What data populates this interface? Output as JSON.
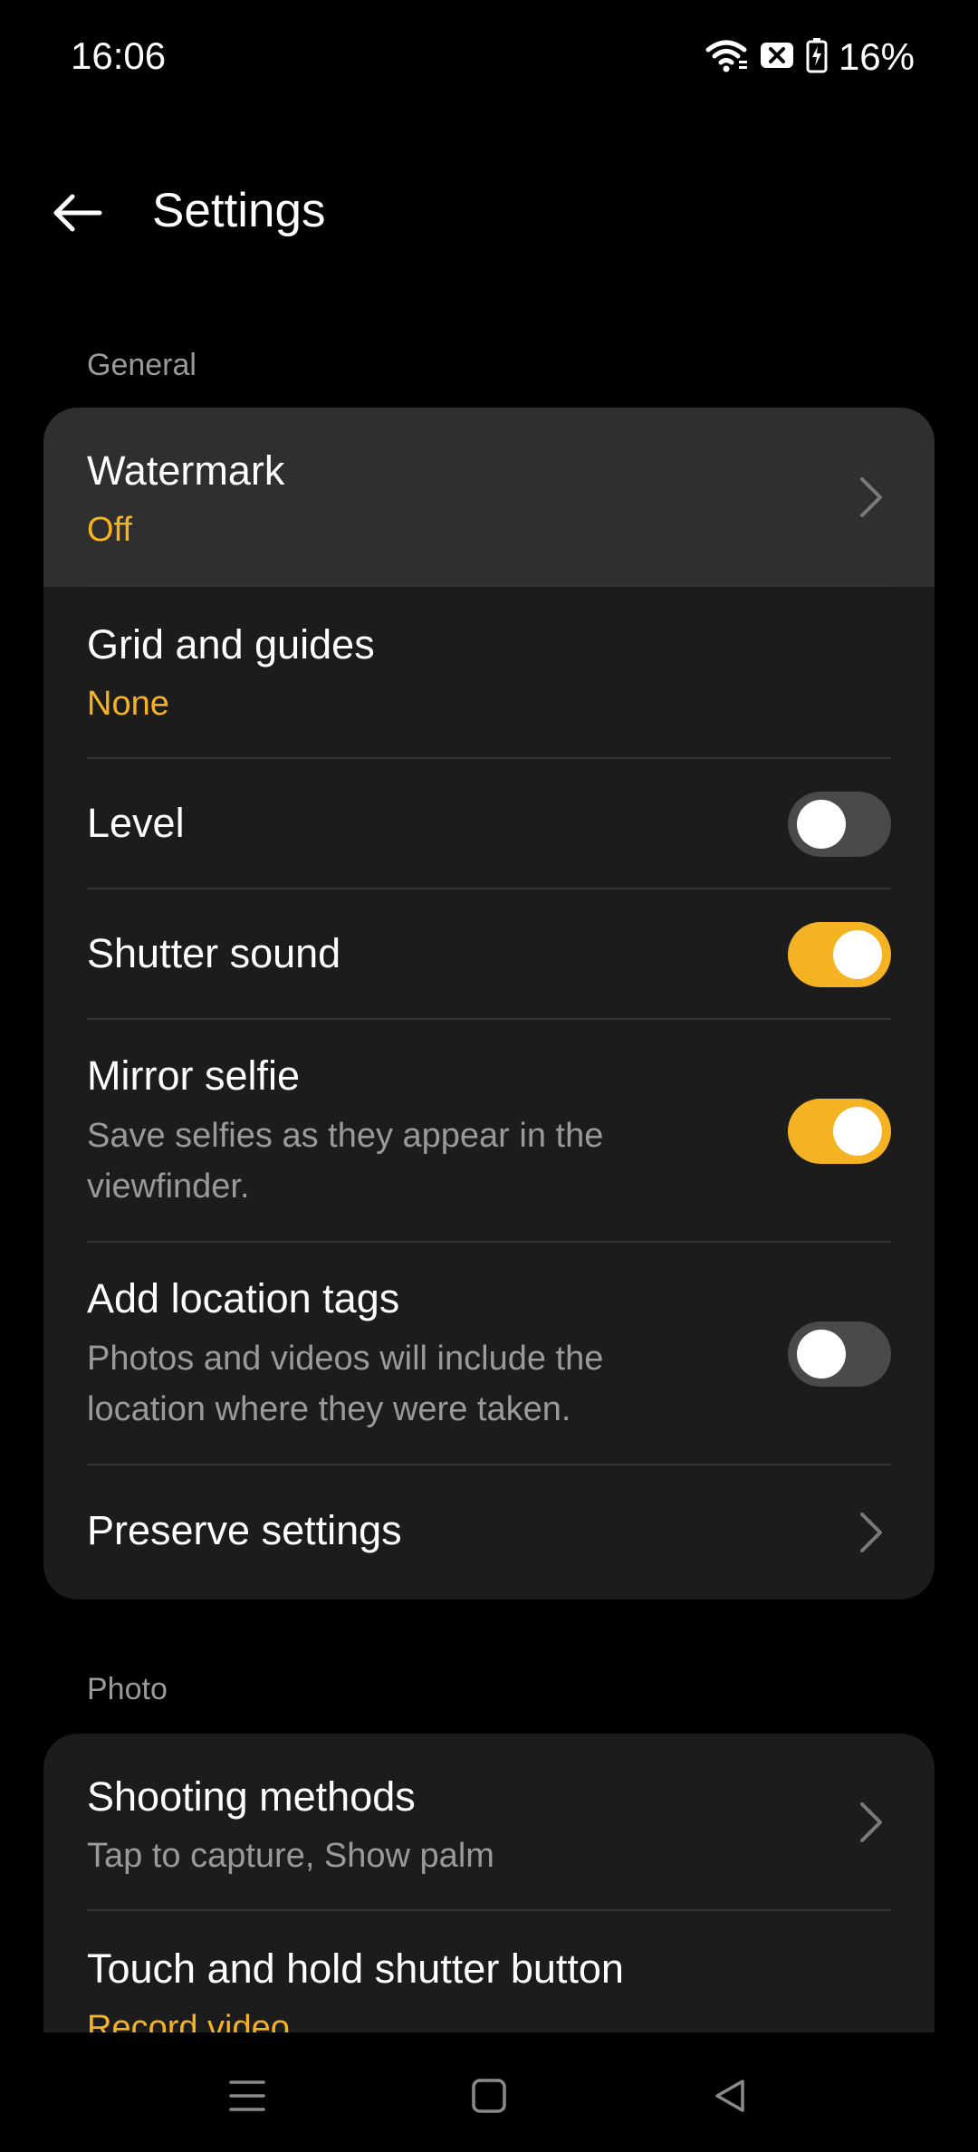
{
  "status_bar": {
    "time": "16:06",
    "battery": "16%",
    "icons": [
      "wifi-icon",
      "no-sim-icon",
      "battery-charging-icon"
    ]
  },
  "app_bar": {
    "title": "Settings",
    "back_icon": "arrow-left-icon"
  },
  "colors": {
    "accent": "#f5b324",
    "card": "#1c1c1c",
    "background": "#000000"
  },
  "general": {
    "label": "General",
    "watermark": {
      "title": "Watermark",
      "value": "Off"
    },
    "grid": {
      "title": "Grid and guides",
      "value": "None"
    },
    "level": {
      "title": "Level",
      "enabled": false
    },
    "shutter_sound": {
      "title": "Shutter sound",
      "enabled": true
    },
    "mirror_selfie": {
      "title": "Mirror selfie",
      "description": "Save selfies as they appear in the viewfinder.",
      "enabled": true
    },
    "location_tags": {
      "title": "Add location tags",
      "description": "Photos and videos will include the location where they were taken.",
      "enabled": false
    },
    "preserve": {
      "title": "Preserve settings"
    }
  },
  "photo": {
    "label": "Photo",
    "shooting_methods": {
      "title": "Shooting methods",
      "value": "Tap to capture, Show palm"
    },
    "touch_hold": {
      "title": "Touch and hold shutter button",
      "value": "Record video"
    }
  },
  "nav_bar": {
    "icons": [
      "menu-icon",
      "home-icon",
      "back-icon"
    ]
  }
}
